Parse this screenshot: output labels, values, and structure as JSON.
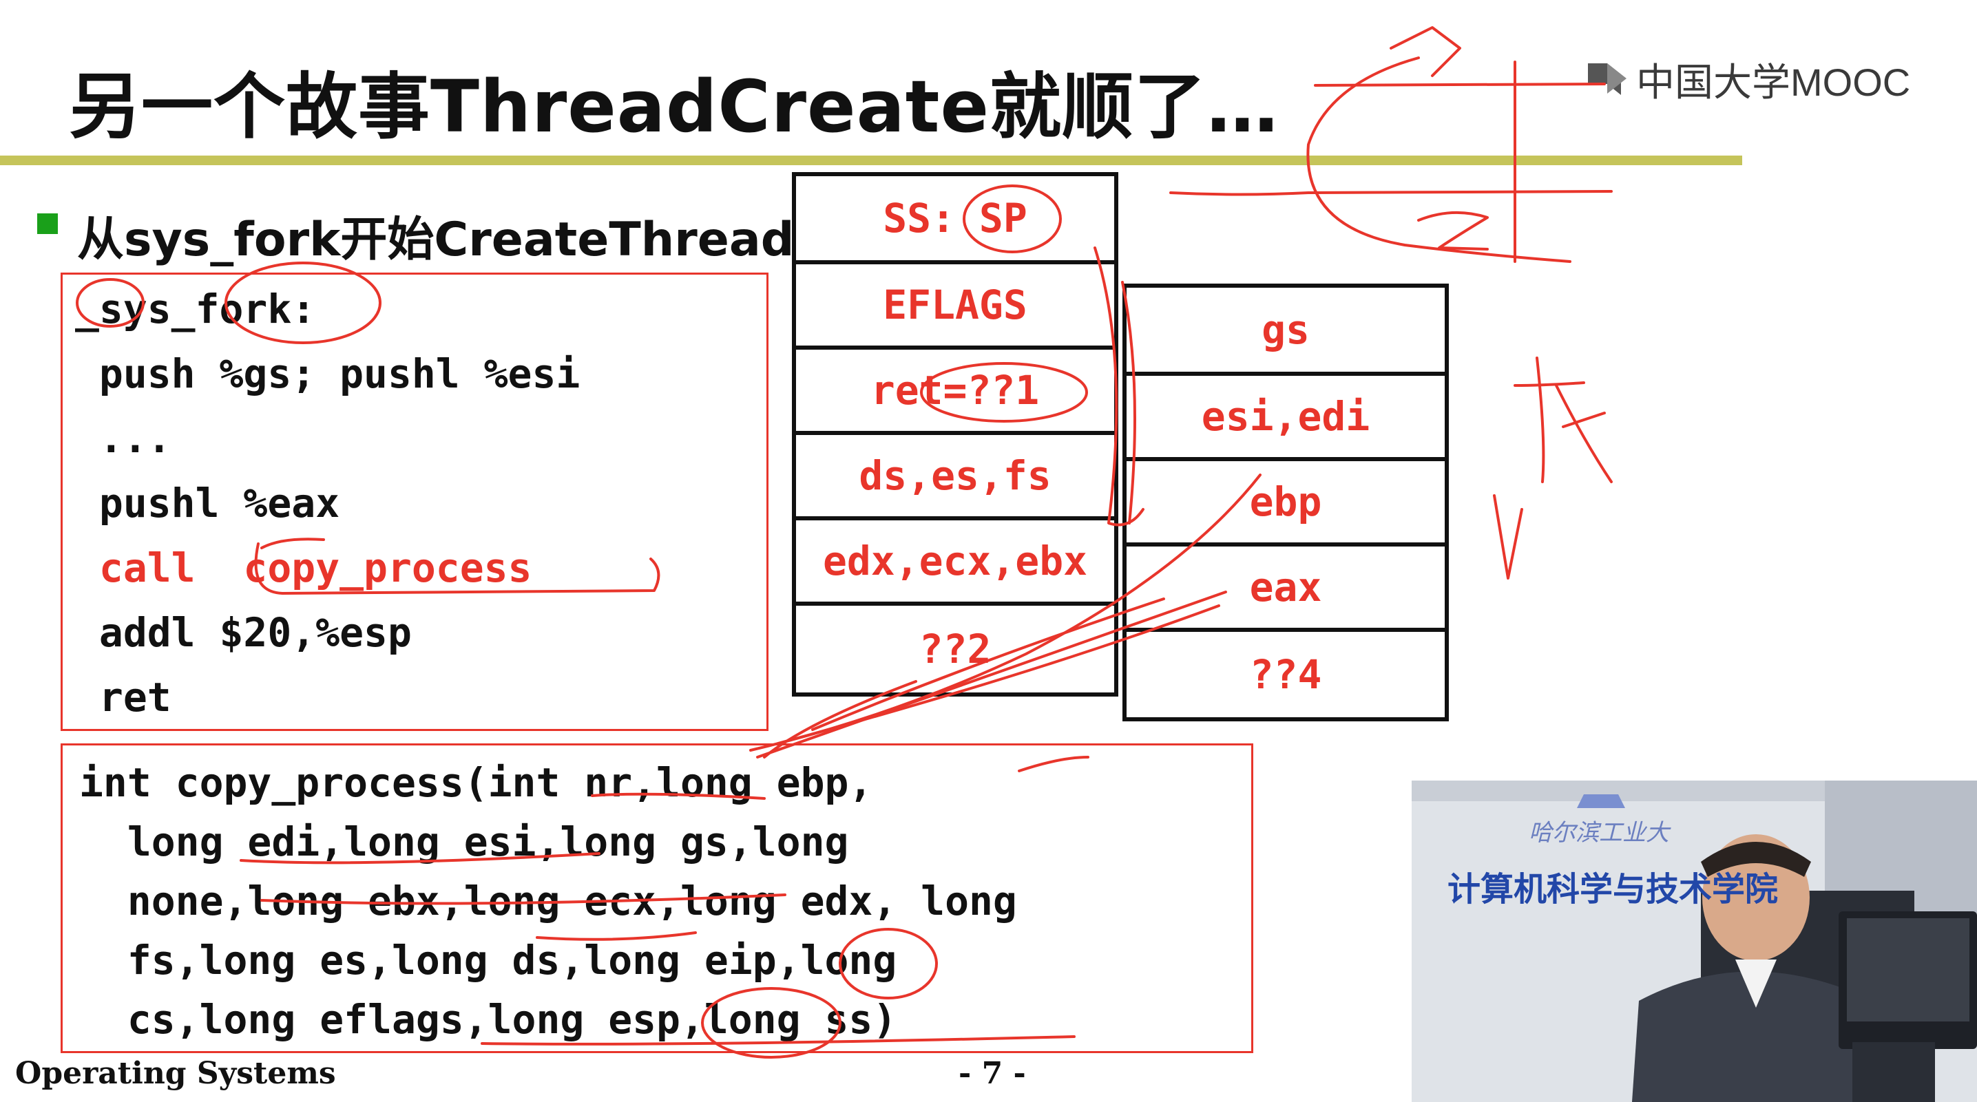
{
  "slide": {
    "title": "另一个故事ThreadCreate就顺了…",
    "bullet": "从sys_fork开始CreateThread"
  },
  "logo": {
    "text": "中国大学MOOC"
  },
  "fork_code": [
    "_sys_fork:",
    " push %gs; pushl %esi",
    " ...",
    " pushl %eax",
    " call  copy_process",
    " addl $20,%esp",
    " ret"
  ],
  "copy_process_code": [
    "int copy_process(int nr,long ebp,",
    "  long edi,long esi,long gs,long",
    "  none,long ebx,long ecx,long edx, long",
    "  fs,long es,long ds,long eip,long",
    "  cs,long eflags,long esp,long ss)"
  ],
  "stack_left": [
    "SS: SP",
    "EFLAGS",
    "ret=??1",
    "ds,es,fs",
    "edx,ecx,ebx",
    "??2"
  ],
  "stack_right": [
    "gs",
    "esi,edi",
    "ebp",
    "eax",
    "??4"
  ],
  "footer": {
    "course": "Operating Systems",
    "page": "- 7 -"
  },
  "video": {
    "banner_top": "哈尔滨工业大",
    "banner": "计算机科学与技术学院"
  },
  "colors": {
    "accent_red": "#e8352b",
    "rule": "#c5c45a",
    "bullet": "#1aa01a"
  }
}
